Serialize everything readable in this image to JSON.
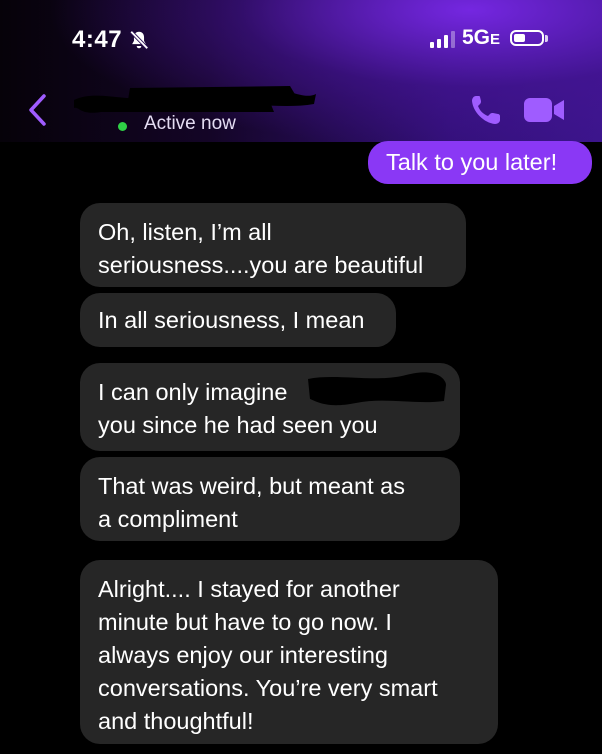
{
  "status_bar": {
    "time": "4:47",
    "network": "5G",
    "network_suffix": "E"
  },
  "header": {
    "presence": "Active now"
  },
  "colors": {
    "accent": "#8a38f5",
    "incoming_bubble": "#262626",
    "online_dot": "#2fcf46"
  },
  "messages": [
    {
      "direction": "outgoing",
      "text": "Talk to you later!"
    },
    {
      "direction": "incoming",
      "lines": [
        "Oh, listen, I’m all",
        "seriousness....you are beautiful"
      ]
    },
    {
      "direction": "incoming",
      "lines": [
        "In all seriousness, I mean"
      ]
    },
    {
      "direction": "incoming",
      "lines": [
        "I can only imagine",
        "you since he had seen you"
      ]
    },
    {
      "direction": "incoming",
      "lines": [
        "That was weird,  but meant as",
        "a compliment"
      ]
    },
    {
      "direction": "incoming",
      "lines": [
        "Alright.... I stayed for another",
        "minute but have to go now.  I",
        "always enjoy our interesting",
        "conversations.  You’re very smart",
        "and thoughtful!"
      ]
    }
  ]
}
